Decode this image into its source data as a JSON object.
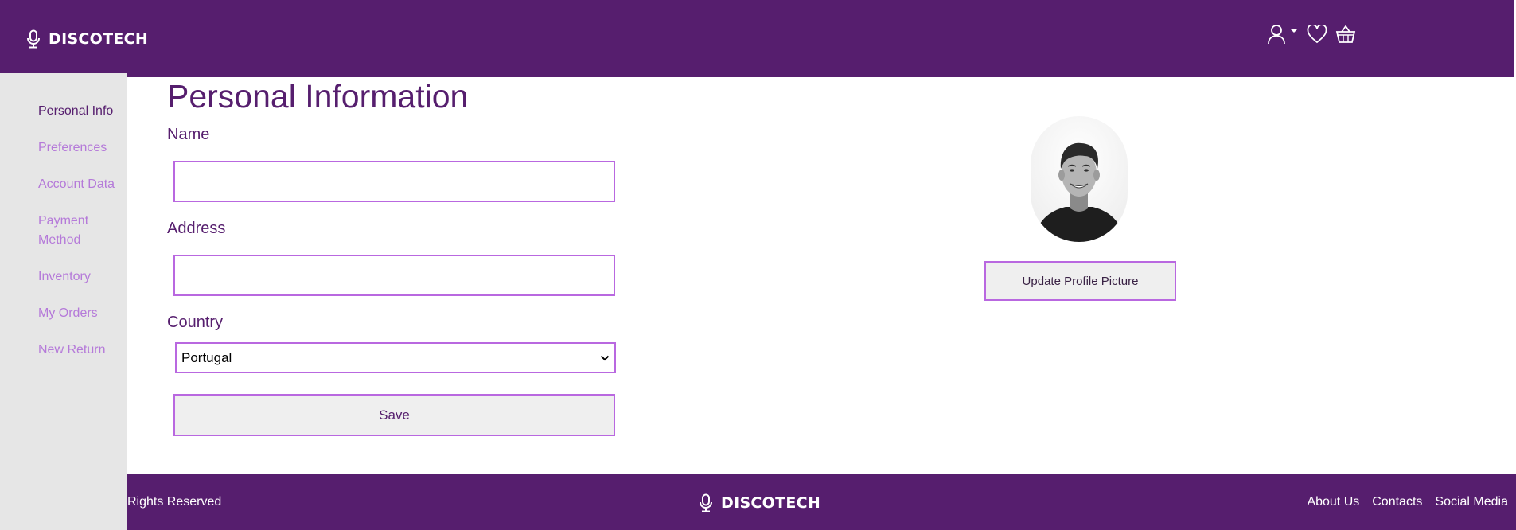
{
  "brand": {
    "name": "DISCOTECH"
  },
  "header": {
    "icons": [
      "user-icon",
      "caret-down-icon",
      "heart-icon",
      "basket-icon"
    ]
  },
  "sidebar": {
    "items": [
      {
        "label": "Personal Info",
        "active": true
      },
      {
        "label": "Preferences",
        "active": false
      },
      {
        "label": "Account Data",
        "active": false
      },
      {
        "label": "Payment Method",
        "active": false
      },
      {
        "label": "Inventory",
        "active": false
      },
      {
        "label": "My Orders",
        "active": false
      },
      {
        "label": "New Return",
        "active": false
      }
    ]
  },
  "main": {
    "title": "Personal Information",
    "name_label": "Name",
    "name_value": "",
    "address_label": "Address",
    "address_value": "",
    "country_label": "Country",
    "country_value": "Portugal",
    "save_label": "Save",
    "update_picture_label": "Update Profile Picture"
  },
  "footer": {
    "rights": "Rights Reserved",
    "links": [
      "About Us",
      "Contacts",
      "Social Media"
    ]
  },
  "colors": {
    "brand_purple": "#561e6e",
    "accent_light_purple": "#b968e0",
    "sidebar_bg": "#e6e6e6"
  }
}
